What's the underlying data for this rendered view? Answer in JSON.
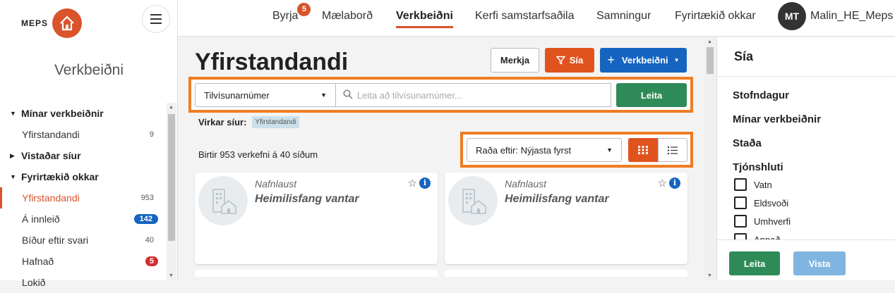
{
  "brand": {
    "logo_text": "MEPS",
    "accent": "#d9532b"
  },
  "sidebar": {
    "title": "Verkbeiðni",
    "rows": [
      {
        "kind": "group",
        "caret": "▼",
        "label": "Mínar verkbeiðnir"
      },
      {
        "kind": "item",
        "label": "Yfirstandandi",
        "count": "9"
      },
      {
        "kind": "group",
        "caret": "▶",
        "label": "Vistaðar síur"
      },
      {
        "kind": "group",
        "caret": "▼",
        "label": "Fyrirtækið okkar"
      },
      {
        "kind": "item",
        "label": "Yfirstandandi",
        "count": "953",
        "active": true
      },
      {
        "kind": "item",
        "label": "Á innleið",
        "pill": "142",
        "pill_color": "blue"
      },
      {
        "kind": "item",
        "label": "Bíður eftir svari",
        "count": "40"
      },
      {
        "kind": "item",
        "label": "Hafnað",
        "pill": "5",
        "pill_color": "red"
      },
      {
        "kind": "item",
        "label": "Lokið"
      }
    ]
  },
  "topnav": {
    "items": [
      {
        "label": "Byrja",
        "badge": "5"
      },
      {
        "label": "Mælaborð"
      },
      {
        "label": "Verkbeiðni",
        "active": true
      },
      {
        "label": "Kerfi samstarfsaðila"
      },
      {
        "label": "Samningur"
      },
      {
        "label": "Fyrirtækið okkar"
      }
    ],
    "avatar_initials": "MT",
    "username": "Malin_HE_Meps"
  },
  "main": {
    "title": "Yfirstandandi",
    "buttons": {
      "merkja": "Merkja",
      "sia": "Sía",
      "verkbeidni": "Verkbeiðni"
    },
    "search": {
      "field_select": "Tilvísunarnúmer",
      "placeholder": "Leita að tilvísunarnúmer...",
      "button": "Leita"
    },
    "active_filters_label": "Virkar síur:",
    "active_filter_tag": "Yfirstandandi",
    "result_text": "Birtir 953 verkefni á 40 síðum",
    "sort_select": "Raða eftir: Nýjasta fyrst",
    "cards": [
      {
        "name": "Nafnlaust",
        "address": "Heimilisfang vantar"
      },
      {
        "name": "Nafnlaust",
        "address": "Heimilisfang vantar"
      }
    ]
  },
  "filter_panel": {
    "title": "Sía",
    "sections": [
      "Stofndagur",
      "Mínar verkbeiðnir",
      "Staða",
      "Tjónshluti"
    ],
    "checkboxes": [
      "Vatn",
      "Eldsvoði",
      "Umhverfi",
      "Annað"
    ],
    "leita_button": "Leita",
    "vista_button": "Vista"
  }
}
